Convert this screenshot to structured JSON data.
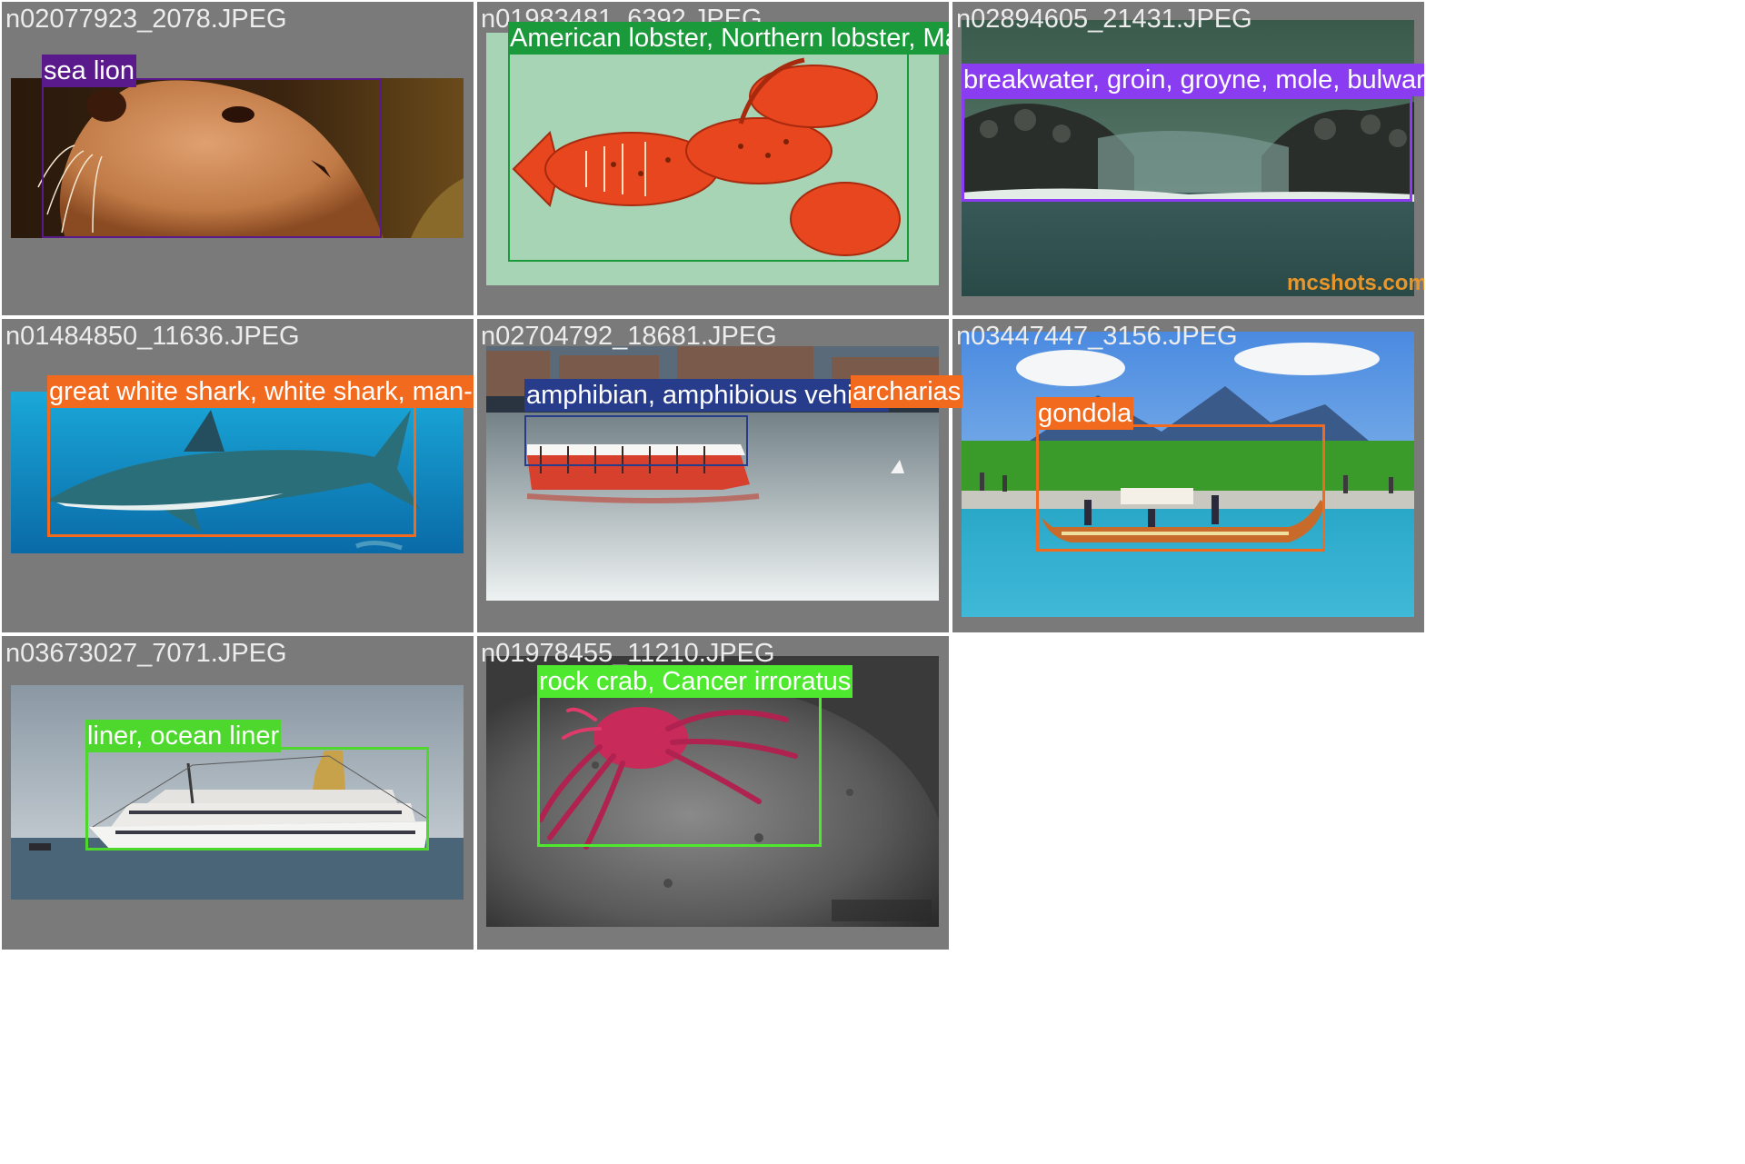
{
  "colors": {
    "cell_background": "#7a7a7a",
    "sea_lion": "#5a1a8c",
    "lobster": "#1a9a3a",
    "breakwater": "#8a3cf0",
    "shark": "#f26a1e",
    "amphibian": "#283c8c",
    "gondola": "#f26a1e",
    "liner": "#4ed82e",
    "crab": "#4ee82e"
  },
  "grid": [
    {
      "filename": "n02077923_2078.JPEG",
      "labels": [
        "sea lion"
      ]
    },
    {
      "filename": "n01983481_6392.JPEG",
      "labels": [
        "American lobster, Northern lobster, Maine lobster, Homarus americanus"
      ]
    },
    {
      "filename": "n02894605_21431.JPEG",
      "labels": [
        "breakwater, groin, groyne, mole, bulwark, se"
      ],
      "watermark": "mcshots.com"
    },
    {
      "filename": "n01484850_11636.JPEG",
      "labels": [
        "great white shark, white shark, man-eater, ma",
        "archarias"
      ]
    },
    {
      "filename": "n02704792_18681.JPEG",
      "labels": [
        "amphibian, amphibious vehicle"
      ]
    },
    {
      "filename": "n03447447_3156.JPEG",
      "labels": [
        "gondola"
      ]
    },
    {
      "filename": "n03673027_7071.JPEG",
      "labels": [
        "liner, ocean liner"
      ]
    },
    {
      "filename": "n01978455_11210.JPEG",
      "labels": [
        "rock crab, Cancer irroratus"
      ]
    }
  ]
}
